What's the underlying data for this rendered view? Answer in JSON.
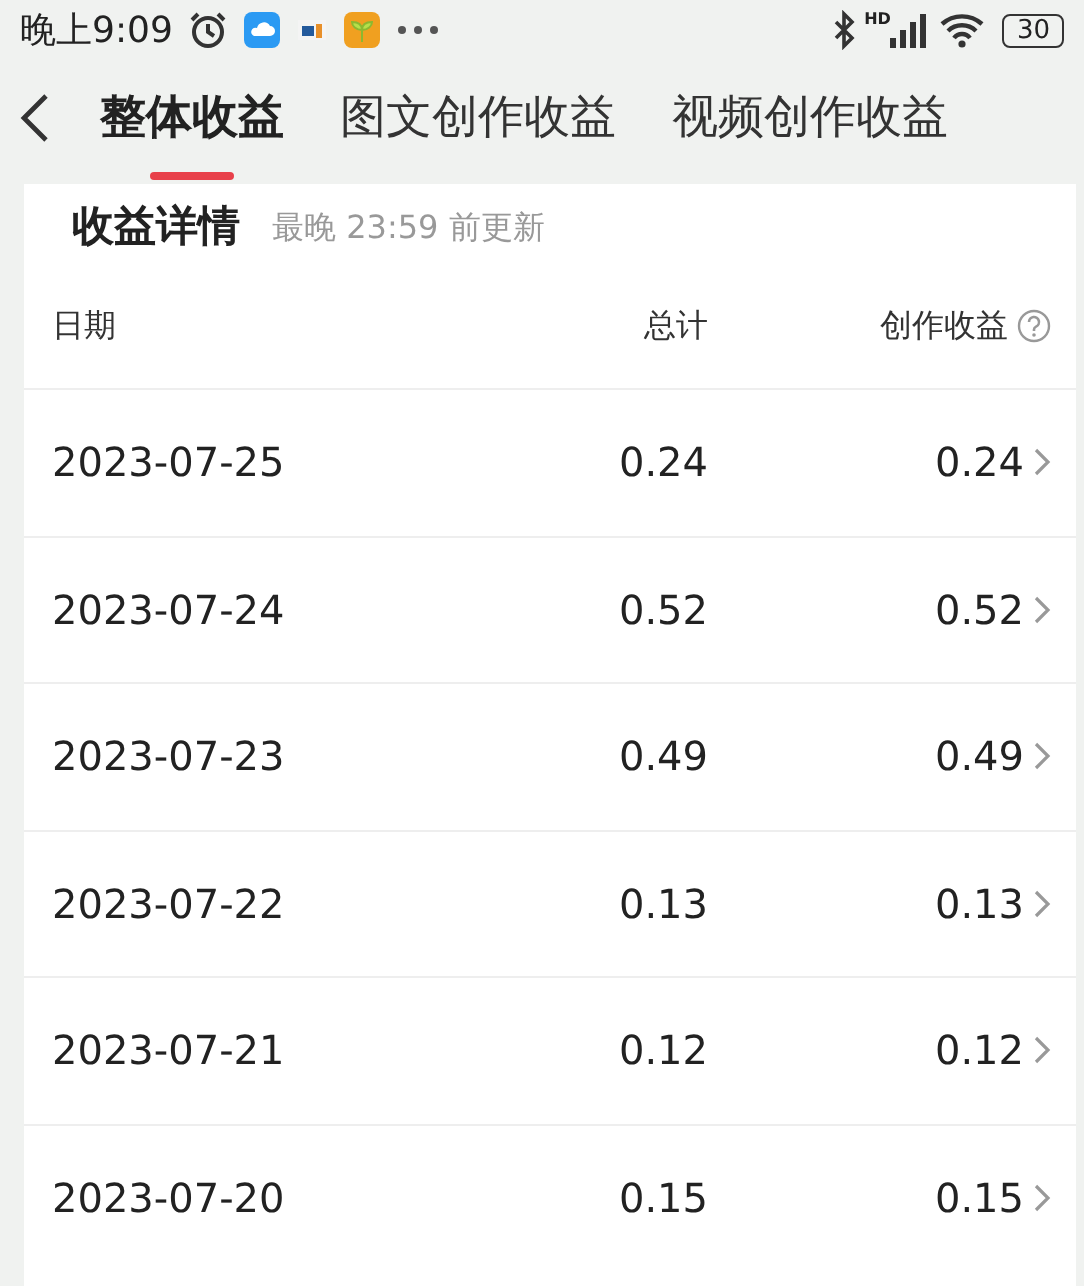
{
  "status_bar": {
    "time": "晚上9:09",
    "network_label": "HD",
    "battery": "30"
  },
  "tabs": [
    {
      "label": "整体收益",
      "selected": true
    },
    {
      "label": "图文创作收益",
      "selected": false
    },
    {
      "label": "视频创作收益",
      "selected": false
    }
  ],
  "card": {
    "title": "收益详情",
    "subtitle": "最晚 23:59 前更新",
    "columns": [
      "日期",
      "总计",
      "创作收益"
    ],
    "rows": [
      {
        "date": "2023-07-25",
        "total": "0.24",
        "creation": "0.24"
      },
      {
        "date": "2023-07-24",
        "total": "0.52",
        "creation": "0.52"
      },
      {
        "date": "2023-07-23",
        "total": "0.49",
        "creation": "0.49"
      },
      {
        "date": "2023-07-22",
        "total": "0.13",
        "creation": "0.13"
      },
      {
        "date": "2023-07-21",
        "total": "0.12",
        "creation": "0.12"
      },
      {
        "date": "2023-07-20",
        "total": "0.15",
        "creation": "0.15"
      }
    ]
  }
}
